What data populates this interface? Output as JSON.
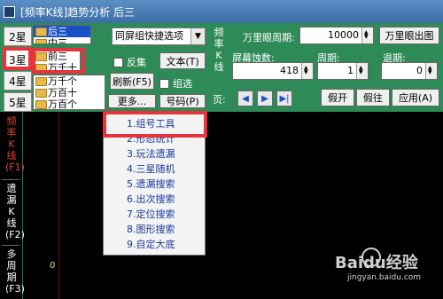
{
  "title": "[频率K线]趋势分析 后三",
  "stars": [
    "2星",
    "3星",
    "4星",
    "5星"
  ],
  "active_star": "3星",
  "list_a": [
    "后三",
    "中三"
  ],
  "list_b": [
    "前三",
    "万千十"
  ],
  "list_c": [
    "万千个",
    "万百十",
    "万百个"
  ],
  "combo_value": "同屏组快捷选项",
  "checks": {
    "invert": "反集",
    "group": "组选"
  },
  "buttons": {
    "text": "文本(T)",
    "refresh": "刷新(F5)",
    "more": "更多...",
    "number": "号码(P)"
  },
  "mid_label": "频率K线",
  "page_label": "页:",
  "right": {
    "period_label": "万里眼周期:",
    "period_value": "10000",
    "eye_button": "万里眼出图",
    "screen_label": "屏幕蚀数:",
    "screen_value": "418",
    "cycle_label": "周期:",
    "cycle_value": "1",
    "lag_label": "退期:",
    "lag_value": "0",
    "btn_open": "假开",
    "btn_close": "假往",
    "btn_apply": "应用(A)"
  },
  "left_labels": {
    "top": "频率K线(F1)",
    "mid": "遗漏K线(F2)",
    "bot": "多周期(F3)"
  },
  "zero_label": "0",
  "menu_items": [
    "1.组号工具",
    "2.形态统计",
    "3.玩法遗漏",
    "4.三星随机",
    "5.遗漏搜索",
    "6.出次搜索",
    "7.定位搜索",
    "8.图形搜索",
    "9.自定大底"
  ],
  "watermark": "Baidu经验",
  "watermark_url": "jingyan.baidu.com"
}
